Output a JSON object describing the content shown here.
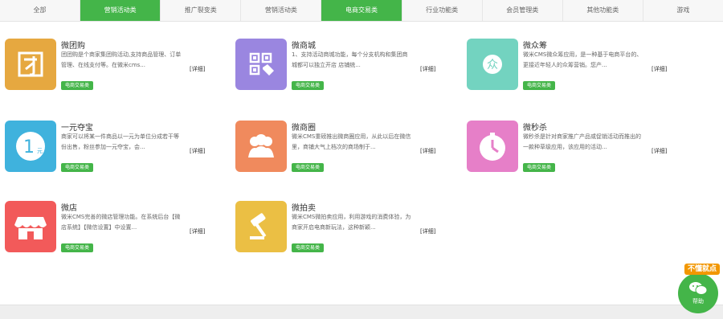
{
  "tabs": [
    {
      "label": "全部",
      "active": false
    },
    {
      "label": "营销活动类",
      "active": true
    },
    {
      "label": "推广裂变类",
      "active": false
    },
    {
      "label": "营销活动类",
      "active": false
    },
    {
      "label": "电商交易类",
      "active": true
    },
    {
      "label": "行业功能类",
      "active": false
    },
    {
      "label": "会员管理类",
      "active": false
    },
    {
      "label": "其他功能类",
      "active": false
    },
    {
      "label": "游戏",
      "active": false
    }
  ],
  "cards": [
    {
      "title": "微团购",
      "desc": "团团购是个商家集团购活动,支持商品管理、订单管理、在线支付等。在微米cms...",
      "detail": "[详细]",
      "badge": "电商交易类",
      "icon": "tuan-icon",
      "color": "#e6a840"
    },
    {
      "title": "微商城",
      "desc": "1、支持活动商城功能，每个分支机构和集团商城都可以独立开店     店铺统...",
      "detail": "[详细]",
      "badge": "电商交易类",
      "icon": "qr-tag-icon",
      "color": "#9a86e0"
    },
    {
      "title": "微众筹",
      "desc": "微米CMS微众筹应用，是一种基于电商平台的、更接近年轻人的众筹营销。您产...",
      "detail": "[详细]",
      "badge": "电商交易类",
      "icon": "zhong-icon",
      "color": "#73d3c0"
    },
    {
      "title": "一元夺宝",
      "desc": "商家可以将某一件商品以一元为单位分成若干等份出售，粉丝参加一元夺宝，会...",
      "detail": "[详细]",
      "badge": "电商交易类",
      "icon": "one-yuan-icon",
      "color": "#3fb2dd"
    },
    {
      "title": "微商圈",
      "desc": "微米CMS重磅推出微商圈应用，从此以后在微信里，商铺大气上档次的商场制于...",
      "detail": "[详细]",
      "badge": "电商交易类",
      "icon": "people-icon",
      "color": "#f08a5d"
    },
    {
      "title": "微秒杀",
      "desc": "微秒杀是针对商家推广产品或促销活动而推出的一款种草级应用，该应用的活动...",
      "detail": "[详细]",
      "badge": "电商交易类",
      "icon": "clock-icon",
      "color": "#e67fc8"
    },
    {
      "title": "微店",
      "desc": "微米CMS完善的微店管理功能。在系统后台【微店系统】【微信设置】中设置...",
      "detail": "[详细]",
      "badge": "电商交易类",
      "icon": "shop-icon",
      "color": "#f25a5a"
    },
    {
      "title": "微拍卖",
      "desc": "微米CMS微拍卖应用，利用游戏的消费体验，为商家开启电商新玩法，这种新颖...",
      "detail": "[详细]",
      "badge": "电商交易类",
      "icon": "gavel-icon",
      "color": "#ebbf44"
    }
  ],
  "help": {
    "tag": "不懂就点",
    "label": "帮助"
  }
}
